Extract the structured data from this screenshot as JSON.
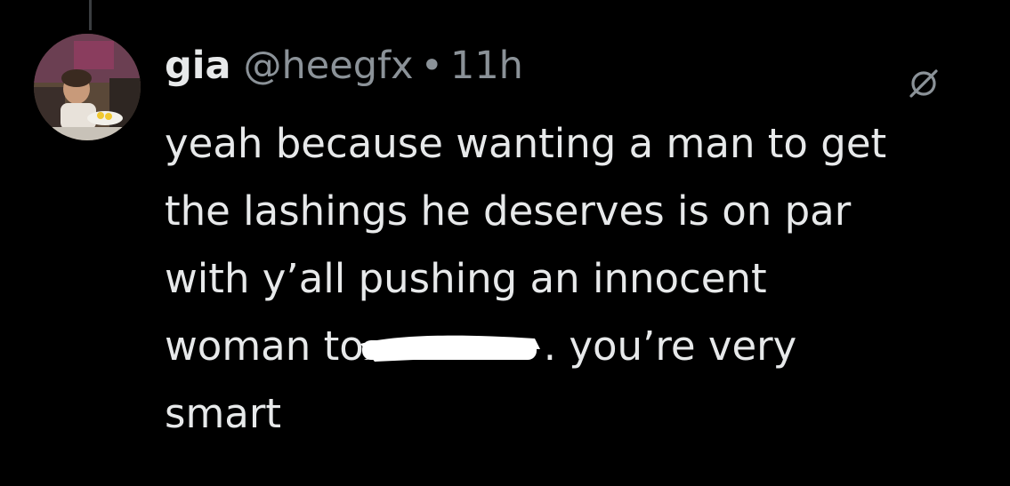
{
  "tweet": {
    "display_name": "gia",
    "handle": "@heegfx",
    "separator": "•",
    "time": "11h",
    "text_lines": {
      "l1": "yeah because wanting a man to get",
      "l2": "the lashings he deserves is on par",
      "l3": "with y’all pushing an innocent",
      "l4_before": "woman to",
      "l4_after": ". you’re very",
      "l5": "smart"
    }
  },
  "icons": {
    "avatar": "avatar-photo",
    "grok": "grok-icon"
  },
  "colors": {
    "background": "#000000",
    "text": "#e7e9ea",
    "secondary": "#8b9298",
    "redaction": "#ffffff"
  }
}
